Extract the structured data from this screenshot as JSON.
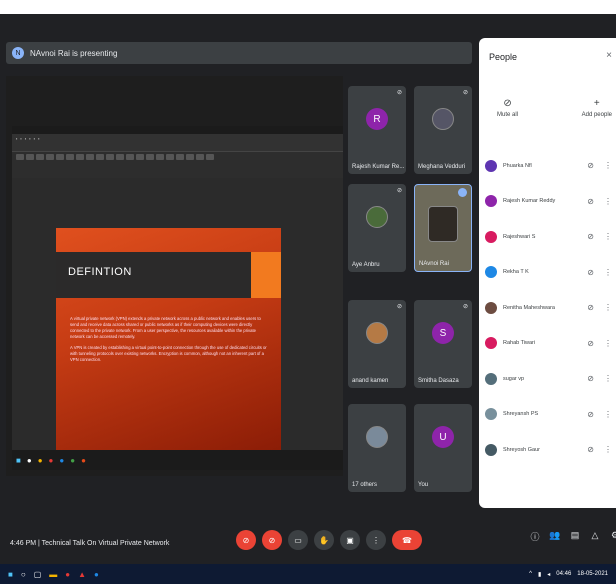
{
  "presenter": {
    "label": "NAvnoi Rai is presenting"
  },
  "slide": {
    "title": "DEFINTION",
    "para1": "A virtual private network (VPN) extends a private network across a public network and enables users to send and receive data across shared or public networks as if their computing devices were directly connected to the private network. From a user perspective, the resources available within the private network can be accessed remotely.",
    "para2": "A VPN is created by establishing a virtual point-to-point connection through the use of dedicated circuits or with tunneling protocols over existing networks. Encryption is common, although not an inherent part of a VPN connection."
  },
  "tiles": [
    {
      "name": "Rajesh Kumar Re...",
      "initial": "R",
      "color": "#8e24aa"
    },
    {
      "name": "Meghana Vedduri",
      "initial": "",
      "color": ""
    },
    {
      "name": "Aye Anbru",
      "initial": "",
      "color": ""
    },
    {
      "name": "NAvnoi Rai",
      "initial": "",
      "color": ""
    },
    {
      "name": "anand kamen",
      "initial": "",
      "color": ""
    },
    {
      "name": "Smitha Dasaza",
      "initial": "S",
      "color": "#8e24aa"
    },
    {
      "name": "17 others",
      "initial": "",
      "color": ""
    },
    {
      "name": "You",
      "initial": "U",
      "color": "#8e24aa"
    }
  ],
  "people_panel": {
    "title": "People",
    "close": "×",
    "mute_all": "Mute all",
    "add_people": "Add people",
    "participants": [
      {
        "name": "Phuarka Nfl",
        "color": "#5e35b1"
      },
      {
        "name": "Rajesh Kumar Reddy",
        "color": "#8e24aa"
      },
      {
        "name": "Rajeshwari S",
        "color": "#d81b60"
      },
      {
        "name": "Rekha T K",
        "color": "#1e88e5"
      },
      {
        "name": "Renitha Maheshwara",
        "color": "#6d4c41"
      },
      {
        "name": "Rahab Tiwari",
        "color": "#d81b60"
      },
      {
        "name": "sugar vp",
        "color": "#546e7a"
      },
      {
        "name": "Shreyansh PS",
        "color": "#78909c"
      },
      {
        "name": "Shreyosh Gaur",
        "color": "#455a64"
      }
    ]
  },
  "bottom": {
    "time_meeting": "4:46 PM  |  Technical Talk On Virtual Private Network"
  },
  "taskbar": {
    "clock": "04:46",
    "date": "18-05-2021"
  }
}
